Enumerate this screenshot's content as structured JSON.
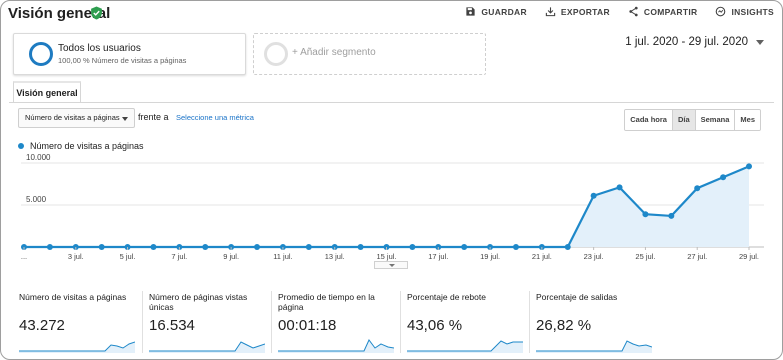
{
  "header": {
    "title": "Visión general",
    "actions": [
      {
        "label": "GUARDAR",
        "icon": "save-icon"
      },
      {
        "label": "EXPORTAR",
        "icon": "download-icon"
      },
      {
        "label": "COMPARTIR",
        "icon": "share-icon"
      },
      {
        "label": "INSIGHTS",
        "icon": "insights-icon"
      }
    ]
  },
  "segments": {
    "active": {
      "title": "Todos los usuarios",
      "subtitle": "100,00 % Número de visitas a páginas"
    },
    "add_label": "+ Añadir segmento"
  },
  "date_range": "1 jul. 2020 - 29 jul. 2020",
  "tab": "Visión general",
  "controls": {
    "metric": "Número de visitas a páginas",
    "versus": "frente a",
    "select_metric": "Seleccione una métrica",
    "granularity": [
      "Cada hora",
      "Día",
      "Semana",
      "Mes"
    ],
    "granularity_selected": "Día"
  },
  "chart_data": {
    "type": "area",
    "series": [
      {
        "name": "Número de visitas a páginas",
        "color": "#1e88c9"
      }
    ],
    "x": [
      "...",
      "2 jul.",
      "3 jul.",
      "4 jul.",
      "5 jul.",
      "6 jul.",
      "7 jul.",
      "8 jul.",
      "9 jul.",
      "10 jul.",
      "11 jul.",
      "12 jul.",
      "13 jul.",
      "14 jul.",
      "15 jul.",
      "16 jul.",
      "17 jul.",
      "18 jul.",
      "19 jul.",
      "20 jul.",
      "21 jul.",
      "22 jul.",
      "23 jul.",
      "24 jul.",
      "25 jul.",
      "26 jul.",
      "27 jul.",
      "28 jul.",
      "29 jul."
    ],
    "values": [
      0,
      0,
      0,
      0,
      0,
      0,
      0,
      0,
      0,
      0,
      0,
      0,
      0,
      0,
      0,
      0,
      0,
      0,
      0,
      0,
      0,
      0,
      6100,
      7100,
      3900,
      3700,
      7000,
      8300,
      9600
    ],
    "tick_labels": [
      "...",
      "3 jul.",
      "5 jul.",
      "7 jul.",
      "9 jul.",
      "11 jul.",
      "13 jul.",
      "15 jul.",
      "17 jul.",
      "19 jul.",
      "21 jul.",
      "23 jul.",
      "25 jul.",
      "27 jul.",
      "29 jul."
    ],
    "tick_indices": [
      0,
      2,
      4,
      6,
      8,
      10,
      12,
      14,
      16,
      18,
      20,
      22,
      24,
      26,
      28
    ],
    "y_ticks": [
      "10.000",
      "5.000"
    ],
    "y_tick_values": [
      10000,
      5000
    ],
    "ylim": [
      0,
      10000
    ],
    "grid": true
  },
  "scorecards": [
    {
      "label": "Número de visitas a páginas",
      "value": "43.272"
    },
    {
      "label": "Número de páginas vistas únicas",
      "value": "16.534"
    },
    {
      "label": "Promedio de tiempo en la página",
      "value": "00:01:18"
    },
    {
      "label": "Porcentaje de rebote",
      "value": "43,06 %"
    },
    {
      "label": "Porcentaje de salidas",
      "value": "26,82 %"
    }
  ],
  "colors": {
    "accent": "#1e88c9",
    "segment_ring": "#1e7bc1",
    "link": "#1a73c8",
    "verified": "#2e9e4f"
  }
}
